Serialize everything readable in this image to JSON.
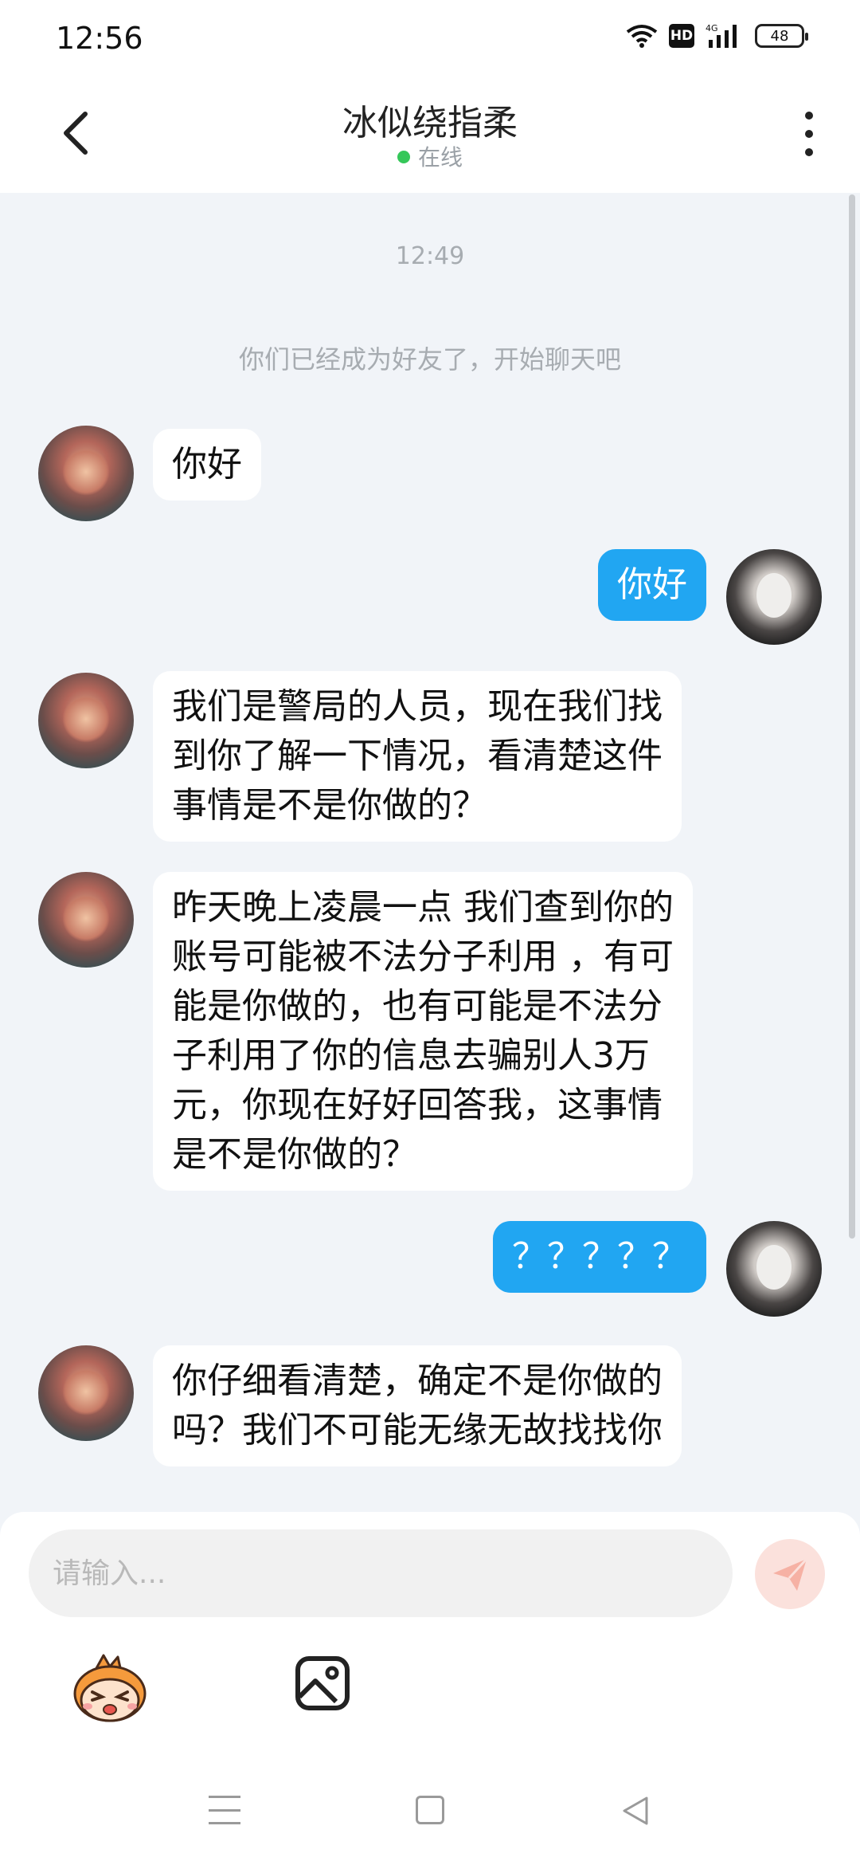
{
  "status_bar": {
    "time": "12:56",
    "hd": "HD",
    "network": "4G",
    "battery": "48"
  },
  "header": {
    "title": "冰似绕指柔",
    "status": "在线",
    "icons": [
      "chevron-left-icon",
      "more-vertical-icon"
    ]
  },
  "chat": {
    "timestamp": "12:49",
    "system_message": "你们已经成为好友了，开始聊天吧",
    "messages": [
      {
        "sender": "contact",
        "lines": [
          "你好"
        ]
      },
      {
        "sender": "me",
        "lines": [
          "你好"
        ]
      },
      {
        "sender": "contact",
        "lines": [
          "我们是警局的人员，现在我们找",
          "到你了解一下情况，看清楚这件",
          "事情是不是你做的？"
        ]
      },
      {
        "sender": "contact",
        "lines": [
          "昨天晚上凌晨一点 我们查到你的",
          "账号可能被不法分子利用 ，有可",
          "能是你做的，也有可能是不法分",
          "子利用了你的信息去骗别人3万",
          "元，你现在好好回答我，这事情",
          "是不是你做的？"
        ]
      },
      {
        "sender": "me",
        "lines": [
          "？？？？？"
        ]
      },
      {
        "sender": "contact",
        "lines": [
          "你仔细看清楚，确定不是你做的",
          "吗？我们不可能无缘无故找找你"
        ]
      }
    ]
  },
  "composer": {
    "placeholder": "请输入...",
    "value": "",
    "icons": [
      "send-icon",
      "emoji-mascot-icon",
      "image-icon"
    ],
    "send_color": "#fbe1dc"
  },
  "nav_bar": {
    "icons": [
      "menu-icon",
      "home-icon",
      "back-triangle-icon"
    ]
  },
  "colors": {
    "accent": "#21a6f2",
    "online": "#35c759",
    "background": "#f1f4f8"
  }
}
